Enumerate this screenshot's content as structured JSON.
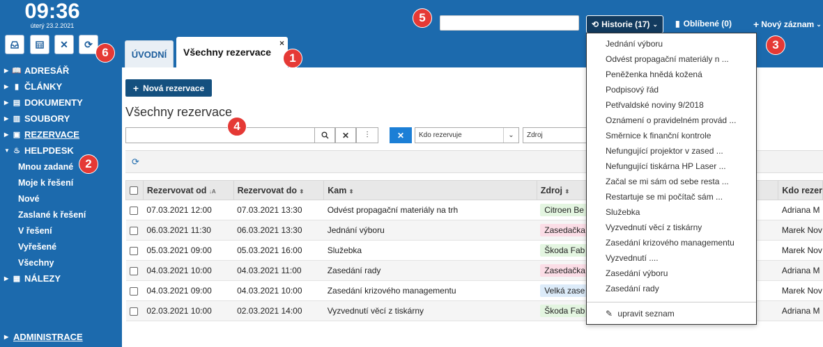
{
  "clock": {
    "time": "09:36",
    "date": "úterý 23.2.2021"
  },
  "sidebar": {
    "tools": [
      "inbox-icon",
      "calendar-icon",
      "close-icon",
      "refresh-icon"
    ],
    "items": [
      {
        "label": "ADRESÁŘ",
        "icon": "book-icon"
      },
      {
        "label": "ČLÁNKY",
        "icon": "bar-chart-icon"
      },
      {
        "label": "DOKUMENTY",
        "icon": "document-icon"
      },
      {
        "label": "SOUBORY",
        "icon": "file-icon"
      },
      {
        "label": "REZERVACE",
        "icon": "presentation-icon"
      },
      {
        "label": "HELPDESK",
        "icon": "fire-icon"
      },
      {
        "label": "NÁLEZY",
        "icon": "grid-icon"
      }
    ],
    "helpdesk_sub": [
      "Mnou zadané",
      "Moje k řešení",
      "Nové",
      "Zaslané k řešení",
      "V řešení",
      "Vyřešené",
      "Všechny"
    ],
    "admin": "ADMINISTRACE"
  },
  "badges": [
    "1",
    "2",
    "3",
    "4",
    "5",
    "6"
  ],
  "header": {
    "history_label": "Historie (17)",
    "favorites_label": "Oblíbené (0)",
    "new_record_label": "Nový záznam"
  },
  "tabs": {
    "home": "ÚVODNÍ",
    "active": "Všechny rezervace",
    "close": "×"
  },
  "main": {
    "new_button": "Nová rezervace",
    "title": "Všechny rezervace",
    "filter_who": "Kdo rezervuje",
    "filter_source": "Zdroj"
  },
  "table": {
    "headers": [
      "Rezervovat od",
      "Rezervovat do",
      "Kam",
      "Zdroj",
      "Kdo rezer"
    ],
    "rows": [
      {
        "from": "07.03.2021 12:00",
        "to": "07.03.2021 13:30",
        "where": "Odvést propagační materiály na trh",
        "source": "Citroen Be",
        "source_color": "#e3f5e0",
        "who": "Adriana M"
      },
      {
        "from": "06.03.2021 11:30",
        "to": "06.03.2021 13:30",
        "where": "Jednání výboru",
        "source": "Zasedačka",
        "source_color": "#fbdde6",
        "who": "Marek Nov"
      },
      {
        "from": "05.03.2021 09:00",
        "to": "05.03.2021 16:00",
        "where": "Služebka",
        "source": "Škoda Fab",
        "source_color": "#e3f5e0",
        "who": "Marek Nov"
      },
      {
        "from": "04.03.2021 10:00",
        "to": "04.03.2021 11:00",
        "where": "Zasedání rady",
        "source": "Zasedačka",
        "source_color": "#fbdde6",
        "who": "Adriana M"
      },
      {
        "from": "04.03.2021 09:00",
        "to": "04.03.2021 10:00",
        "where": "Zasedání krizového managementu",
        "source": "Velká zase",
        "source_color": "#dcebf9",
        "who": "Marek Nov"
      },
      {
        "from": "02.03.2021 10:00",
        "to": "02.03.2021 14:00",
        "where": "Vyzvednutí věcí z tiskárny",
        "source": "Škoda Fab",
        "source_color": "#e3f5e0",
        "who": "Adriana M"
      }
    ]
  },
  "history_menu": {
    "items": [
      "Jednání výboru",
      "Odvést propagační materiály n ...",
      "Peněženka hnědá kožená",
      "Podpisový řád",
      "Petřvaldské noviny 9/2018",
      "Oznámení o pravidelném provád ...",
      "Směrnice k finanční kontrole",
      "Nefungující projektor v zased ...",
      "Nefungující tiskárna HP Laser ...",
      "Začal se mi sám od sebe resta ...",
      "Restartuje se mi počítač sám ...",
      "Služebka",
      "Vyzvednutí věcí z tiskárny",
      "Zasedání krizového managementu",
      "Vyzvednutí ....",
      "Zasedání výboru",
      "Zasedání rady"
    ],
    "edit_label": "upravit seznam"
  }
}
